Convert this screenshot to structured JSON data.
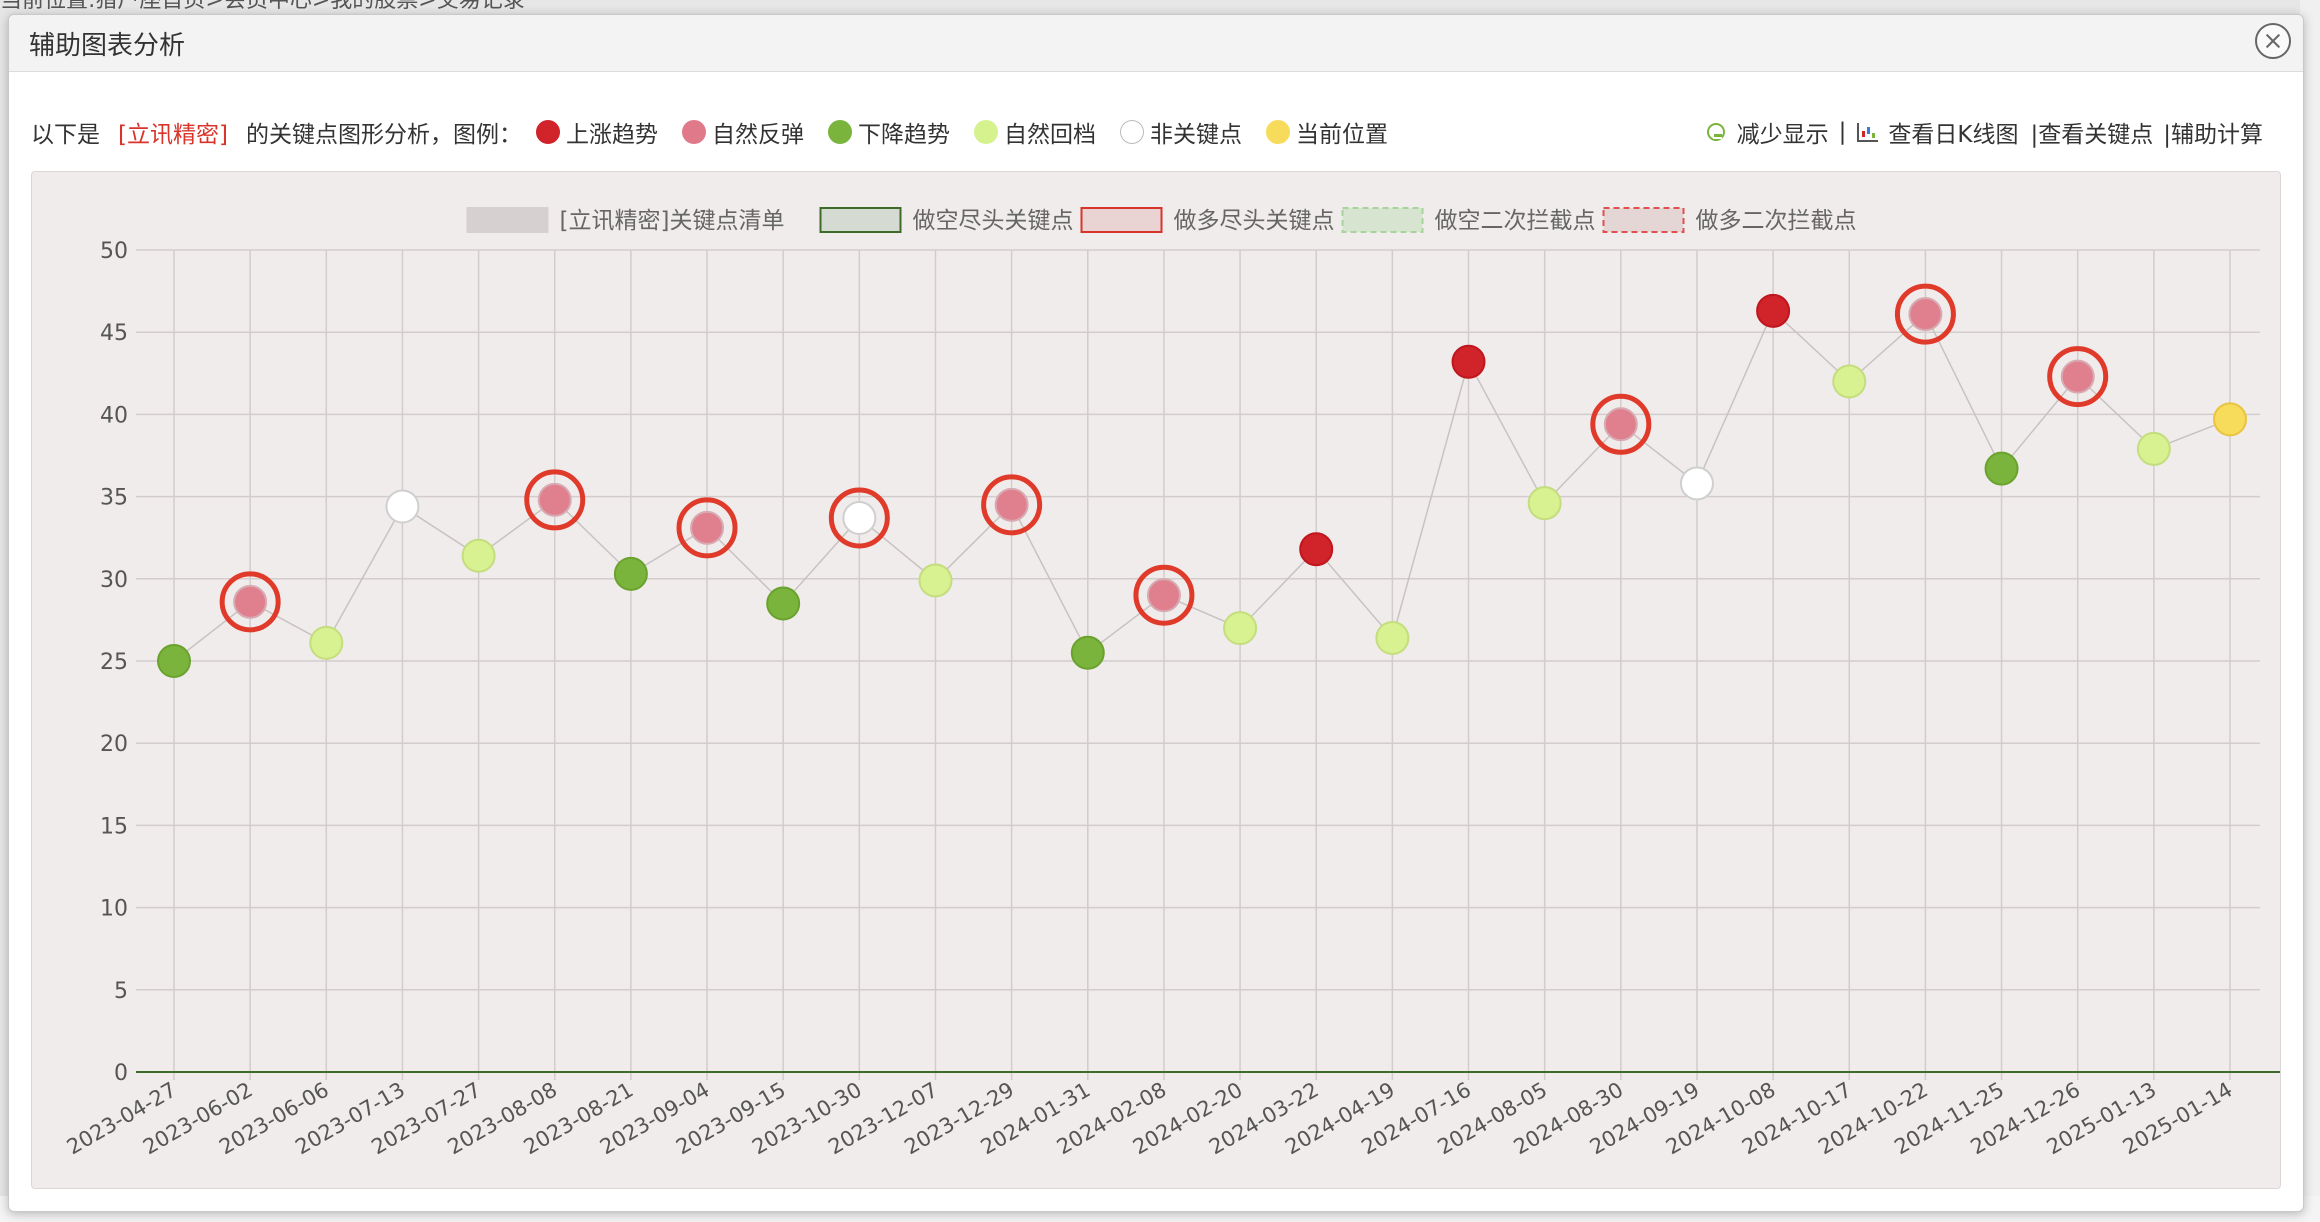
{
  "background": {
    "breadcrumb": "当前位置:猎户座首页>会员中心>我的股票>交易记录"
  },
  "dialog": {
    "title": "辅助图表分析"
  },
  "intro": {
    "prefix": "以下是",
    "stock": "[立讯精密]",
    "suffix": "的关键点图形分析，图例："
  },
  "point_legend": [
    {
      "label": "上涨趋势",
      "color": "#d0232a"
    },
    {
      "label": "自然反弹",
      "color": "#e07a8a"
    },
    {
      "label": "下降趋势",
      "color": "#7ab43c"
    },
    {
      "label": "自然回档",
      "color": "#d6f28f"
    },
    {
      "label": "非关键点",
      "color": "#ffffff"
    },
    {
      "label": "当前位置",
      "color": "#f7db5a"
    }
  ],
  "toolbar": {
    "reduce": "减少显示",
    "sep": "|",
    "kline": "查看日K线图",
    "keypoints": "|查看关键点",
    "calc": "|辅助计算"
  },
  "chart_data": {
    "type": "line",
    "series_legend": [
      {
        "name": "[立讯精密]关键点清单",
        "style": "gray-fill"
      },
      {
        "name": "做空尽头关键点",
        "style": "green-border"
      },
      {
        "name": "做多尽头关键点",
        "style": "red-border"
      },
      {
        "name": "做空二次拦截点",
        "style": "green-dashed"
      },
      {
        "name": "做多二次拦截点",
        "style": "red-dashed"
      }
    ],
    "x": [
      "2023-04-27",
      "2023-06-02",
      "2023-06-06",
      "2023-07-13",
      "2023-07-27",
      "2023-08-08",
      "2023-08-21",
      "2023-09-04",
      "2023-09-15",
      "2023-10-30",
      "2023-12-07",
      "2023-12-29",
      "2024-01-31",
      "2024-02-08",
      "2024-02-20",
      "2024-03-22",
      "2024-04-19",
      "2024-07-16",
      "2024-08-05",
      "2024-08-30",
      "2024-09-19",
      "2024-10-08",
      "2024-10-17",
      "2024-10-22",
      "2024-11-25",
      "2024-12-26",
      "2025-01-13",
      "2025-01-14"
    ],
    "y": [
      25.0,
      28.6,
      26.1,
      34.4,
      31.4,
      34.8,
      30.3,
      33.1,
      28.5,
      33.7,
      29.9,
      34.5,
      25.5,
      29.0,
      27.0,
      31.8,
      26.4,
      43.2,
      34.6,
      39.4,
      35.8,
      46.3,
      42.0,
      46.1,
      36.7,
      42.3,
      37.9,
      39.7
    ],
    "kinds": [
      "down",
      "rebound",
      "pullback",
      "nonkey",
      "pullback",
      "rebound",
      "down",
      "rebound",
      "down",
      "nonkey",
      "pullback",
      "rebound",
      "down",
      "rebound",
      "pullback",
      "up",
      "pullback",
      "up",
      "pullback",
      "rebound",
      "nonkey",
      "up",
      "pullback",
      "rebound",
      "down",
      "rebound",
      "pullback",
      "current"
    ],
    "marked": [
      false,
      true,
      false,
      false,
      false,
      true,
      false,
      true,
      false,
      true,
      false,
      true,
      false,
      true,
      false,
      false,
      false,
      false,
      false,
      true,
      false,
      false,
      false,
      true,
      false,
      true,
      false,
      false
    ],
    "zero_line": 0,
    "ylim": [
      0,
      50
    ],
    "yticks": [
      0,
      5,
      10,
      15,
      20,
      25,
      30,
      35,
      40,
      45,
      50
    ],
    "grid": true,
    "legend_position": "top-center"
  }
}
